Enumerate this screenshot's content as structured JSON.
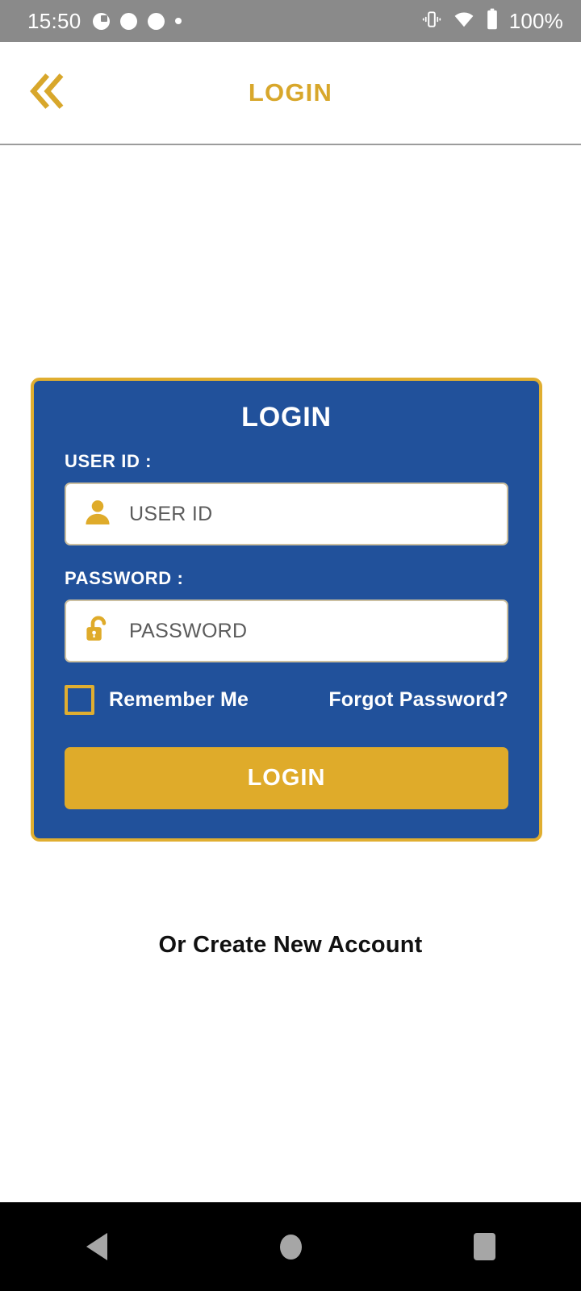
{
  "status_bar": {
    "time": "15:50",
    "battery_percent": "100%",
    "icons": [
      "notification-half-circle-icon",
      "notification-dot-icon",
      "notification-dot-icon",
      "notification-small-dot-icon",
      "vibrate-icon",
      "wifi-icon",
      "battery-full-icon"
    ]
  },
  "header": {
    "title": "LOGIN",
    "back_icon": "double-chevron-left-icon"
  },
  "card": {
    "title": "LOGIN",
    "userid": {
      "label": "USER ID :",
      "placeholder": "USER ID",
      "value": "",
      "icon": "person-icon"
    },
    "password": {
      "label": "PASSWORD :",
      "placeholder": "PASSWORD",
      "value": "",
      "icon": "unlocked-padlock-icon"
    },
    "remember_me": {
      "label": "Remember Me",
      "checked": false
    },
    "forgot_password": "Forgot Password?",
    "submit_label": "LOGIN"
  },
  "footer": {
    "create_account": "Or Create New Account"
  },
  "nav_bar": {
    "back": "nav-back-icon",
    "home": "nav-home-icon",
    "recents": "nav-recents-icon"
  },
  "colors": {
    "brand_blue": "#21519b",
    "brand_gold": "#dfab2a",
    "header_gold": "#d8a72b",
    "status_bar_gray": "#8a8a8a",
    "nav_bar_black": "#000000"
  }
}
